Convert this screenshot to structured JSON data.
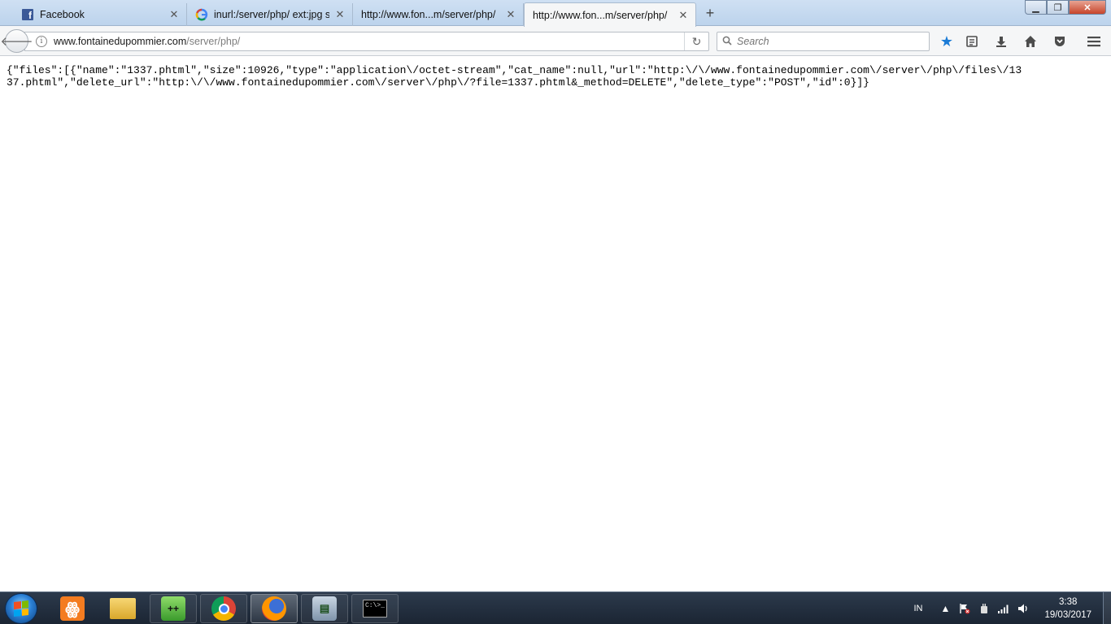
{
  "browser": {
    "tabs": [
      {
        "label": "Facebook",
        "icon": "facebook-icon"
      },
      {
        "label": "inurl:/server/php/ ext:jpg si...",
        "icon": "google-icon"
      },
      {
        "label": "http://www.fon...m/server/php/",
        "icon": ""
      },
      {
        "label": "http://www.fon...m/server/php/",
        "icon": "",
        "active": true
      }
    ],
    "new_tab_label": "+",
    "url_domain": "www.fontainedupommier.com",
    "url_path": "/server/php/",
    "search_placeholder": "Search"
  },
  "page": {
    "json_text": "{\"files\":[{\"name\":\"1337.phtml\",\"size\":10926,\"type\":\"application\\/octet-stream\",\"cat_name\":null,\"url\":\"http:\\/\\/www.fontainedupommier.com\\/server\\/php\\/files\\/1337.phtml\",\"delete_url\":\"http:\\/\\/www.fontainedupommier.com\\/server\\/php\\/?file=1337.phtml&_method=DELETE\",\"delete_type\":\"POST\",\"id\":0}]}"
  },
  "taskbar": {
    "language": "IN",
    "time": "3:38",
    "date": "19/03/2017",
    "cmd_label": "C:\\>_"
  },
  "colors": {
    "accent_star": "#1b7bd6",
    "facebook": "#3b5998"
  }
}
